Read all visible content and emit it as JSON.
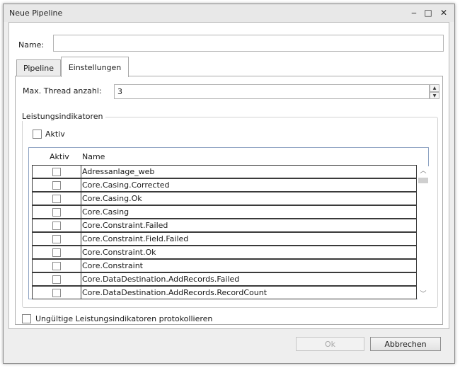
{
  "window": {
    "title": "Neue Pipeline",
    "minimize_glyph": "‒",
    "maximize_glyph": "□",
    "close_glyph": "✕"
  },
  "form": {
    "name_label": "Name:",
    "name_value": ""
  },
  "tabs": [
    {
      "label": "Pipeline",
      "selected": false
    },
    {
      "label": "Einstellungen",
      "selected": true
    }
  ],
  "settings": {
    "thread_label": "Max. Thread anzahl:",
    "thread_value": "3",
    "group_title": "Leistungsindikatoren",
    "aktiv_label": "Aktiv",
    "aktiv_checked": false,
    "grid": {
      "headers": [
        "Aktiv",
        "Name"
      ],
      "rows": [
        {
          "checked": false,
          "name": "Adressanlage_web"
        },
        {
          "checked": false,
          "name": "Core.Casing.Corrected"
        },
        {
          "checked": false,
          "name": "Core.Casing.Ok"
        },
        {
          "checked": false,
          "name": "Core.Casing"
        },
        {
          "checked": false,
          "name": "Core.Constraint.Failed"
        },
        {
          "checked": false,
          "name": "Core.Constraint.Field.Failed"
        },
        {
          "checked": false,
          "name": "Core.Constraint.Ok"
        },
        {
          "checked": false,
          "name": "Core.Constraint"
        },
        {
          "checked": false,
          "name": "Core.DataDestination.AddRecords.Failed"
        },
        {
          "checked": false,
          "name": "Core.DataDestination.AddRecords.RecordCount"
        }
      ]
    }
  },
  "log_invalid_label": "Ungültige Leistungsindikatoren protokollieren",
  "log_invalid_checked": false,
  "buttons": {
    "ok": "Ok",
    "ok_enabled": false,
    "cancel": "Abbrechen"
  }
}
